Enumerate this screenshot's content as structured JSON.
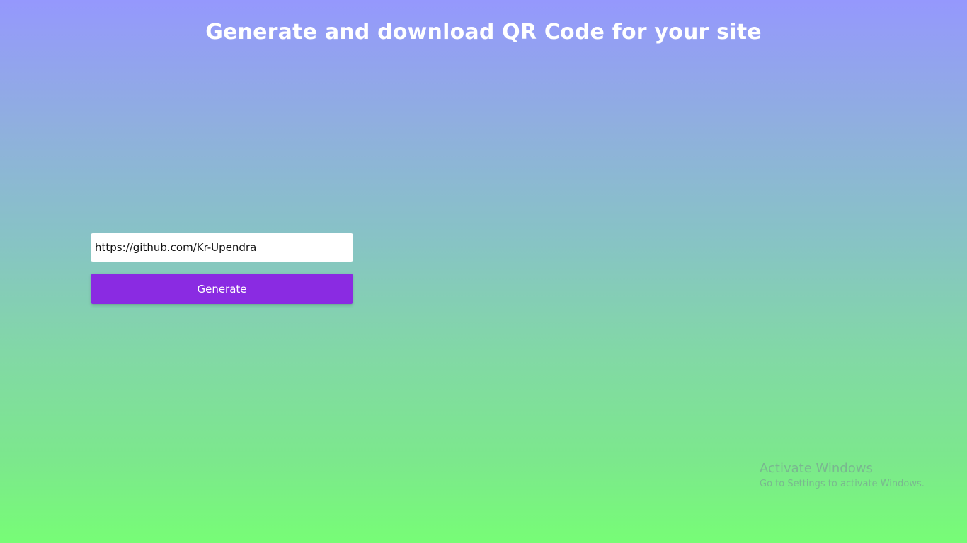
{
  "header": {
    "title": "Generate and download QR Code for your site"
  },
  "form": {
    "url_value": "https://github.com/Kr-Upendra",
    "generate_label": "Generate"
  },
  "watermark": {
    "title": "Activate Windows",
    "subtitle": "Go to Settings to activate Windows."
  },
  "colors": {
    "accent": "#8a2be2",
    "gradient_top": "#9598fd",
    "gradient_bottom": "#77fd76"
  }
}
